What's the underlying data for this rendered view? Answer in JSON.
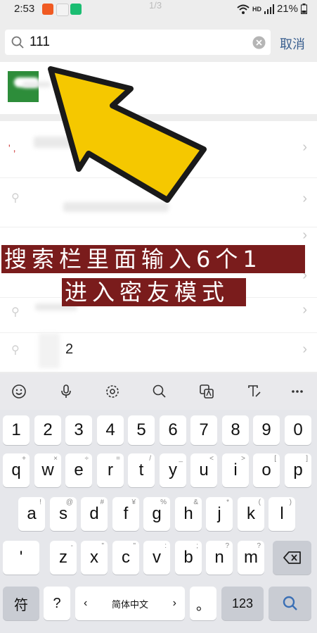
{
  "status": {
    "time": "2:53",
    "page_indicator": "1/3",
    "hd": "HD",
    "battery": "21%"
  },
  "search": {
    "query": "111",
    "cancel": "取消"
  },
  "results": {
    "result_text": "2"
  },
  "annotation": {
    "line1": "搜索栏里面输入6个1",
    "line2": "进入密友模式"
  },
  "keyboard": {
    "numbers": [
      "1",
      "2",
      "3",
      "4",
      "5",
      "6",
      "7",
      "8",
      "9",
      "0"
    ],
    "row1": [
      {
        "k": "q",
        "h": "+"
      },
      {
        "k": "w",
        "h": "×"
      },
      {
        "k": "e",
        "h": "÷"
      },
      {
        "k": "r",
        "h": "="
      },
      {
        "k": "t",
        "h": "/"
      },
      {
        "k": "y",
        "h": "_"
      },
      {
        "k": "u",
        "h": "<"
      },
      {
        "k": "i",
        "h": ">"
      },
      {
        "k": "o",
        "h": "["
      },
      {
        "k": "p",
        "h": "]"
      }
    ],
    "row2": [
      {
        "k": "a",
        "h": "!"
      },
      {
        "k": "s",
        "h": "@"
      },
      {
        "k": "d",
        "h": "#"
      },
      {
        "k": "f",
        "h": "¥"
      },
      {
        "k": "g",
        "h": "%"
      },
      {
        "k": "h",
        "h": "&"
      },
      {
        "k": "j",
        "h": "*"
      },
      {
        "k": "k",
        "h": "("
      },
      {
        "k": "l",
        "h": ")"
      }
    ],
    "row3": [
      {
        "k": "z",
        "h": "-"
      },
      {
        "k": "x",
        "h": "\""
      },
      {
        "k": "c",
        "h": "\""
      },
      {
        "k": "v",
        "h": ":"
      },
      {
        "k": "b",
        "h": ";"
      },
      {
        "k": "n",
        "h": "?"
      },
      {
        "k": "m",
        "h": "?"
      }
    ],
    "apostrophe": "'",
    "symbols": "符",
    "question": "?",
    "lang": "简体中文",
    "period": "。",
    "num_switch": "123"
  },
  "colors": {
    "accent": "#3a6fb5",
    "banner": "#7a1c1c",
    "arrow": "#f5c800"
  }
}
